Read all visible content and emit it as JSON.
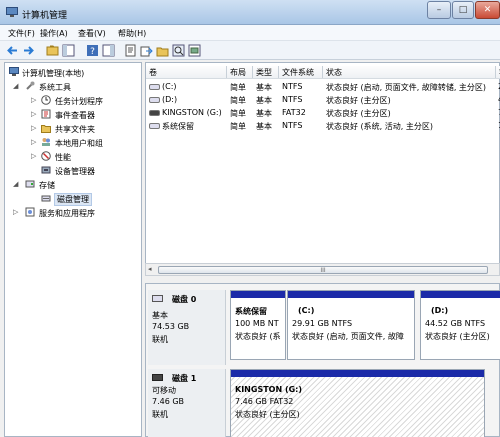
{
  "window": {
    "title": "计算机管理"
  },
  "menu": [
    "文件(F)",
    "操作(A)",
    "查看(V)",
    "帮助(H)"
  ],
  "tree": {
    "root": "计算机管理(本地)",
    "system_tools": "系统工具",
    "task_scheduler": "任务计划程序",
    "event_viewer": "事件查看器",
    "shared_folders": "共享文件夹",
    "local_users": "本地用户和组",
    "performance": "性能",
    "device_manager": "设备管理器",
    "storage": "存储",
    "disk_management": "磁盘管理",
    "services_apps": "服务和应用程序"
  },
  "volume_list": {
    "columns": [
      "卷",
      "布局",
      "类型",
      "文件系统",
      "状态",
      "容"
    ],
    "rows": [
      {
        "volume": "(C:)",
        "layout": "简单",
        "type": "基本",
        "fs": "NTFS",
        "status": "状态良好 (启动, 页面文件, 故障转储, 主分区)",
        "cap": "2"
      },
      {
        "volume": "(D:)",
        "layout": "简单",
        "type": "基本",
        "fs": "NTFS",
        "status": "状态良好 (主分区)",
        "cap": "4"
      },
      {
        "volume": "KINGSTON (G:)",
        "layout": "简单",
        "type": "基本",
        "fs": "FAT32",
        "status": "状态良好 (主分区)",
        "cap": "7"
      },
      {
        "volume": "系统保留",
        "layout": "简单",
        "type": "基本",
        "fs": "NTFS",
        "status": "状态良好 (系统, 活动, 主分区)",
        "cap": "1"
      }
    ],
    "scroll_label": "III"
  },
  "disks": [
    {
      "name": "磁盘 0",
      "kind": "基本",
      "size": "74.53 GB",
      "state": "联机",
      "partitions": [
        {
          "name": "系统保留",
          "detail": "100 MB NT",
          "status": "状态良好 (系"
        },
        {
          "name": "(C:)",
          "detail": "29.91 GB NTFS",
          "status": "状态良好 (启动, 页面文件, 故障"
        },
        {
          "name": "(D:)",
          "detail": "44.52 GB NTFS",
          "status": "状态良好 (主分区)"
        }
      ]
    },
    {
      "name": "磁盘 1",
      "kind": "可移动",
      "size": "7.46 GB",
      "state": "联机",
      "partitions": [
        {
          "name": "KINGSTON  (G:)",
          "detail": "7.46 GB FAT32",
          "status": "状态良好 (主分区)"
        }
      ]
    }
  ],
  "colors": {
    "primary_partition": "#1b2aa8",
    "titlebar": "#b9d1ec"
  }
}
